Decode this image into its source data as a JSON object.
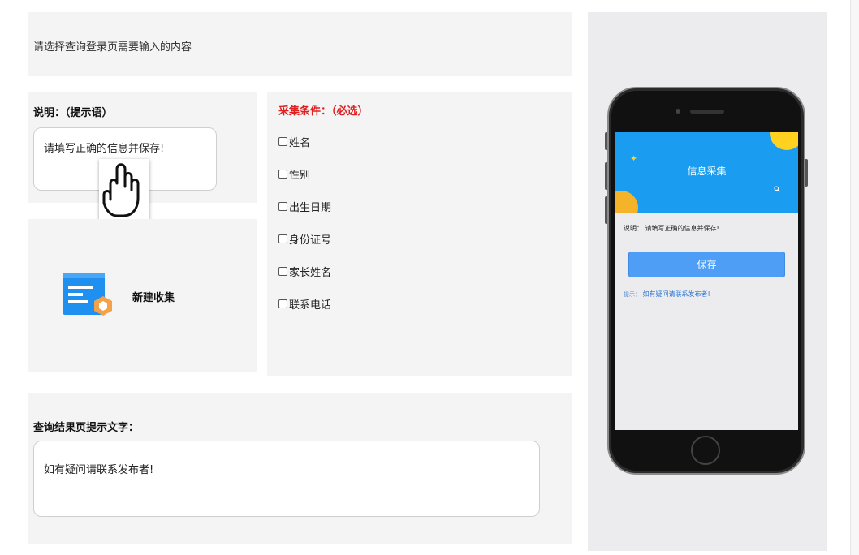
{
  "header": {
    "prompt": "请选择查询登录页需要输入的内容"
  },
  "description": {
    "label": "说明：（提示语）",
    "value": "请填写正确的信息并保存!"
  },
  "new_collection": {
    "label": "新建收集",
    "icon": "form-add-icon"
  },
  "collect_conditions": {
    "title": "采集条件：（必选）",
    "options": [
      {
        "label": "姓名",
        "checked": false
      },
      {
        "label": "性别",
        "checked": false
      },
      {
        "label": "出生日期",
        "checked": false
      },
      {
        "label": "身份证号",
        "checked": false
      },
      {
        "label": "家长姓名",
        "checked": false
      },
      {
        "label": "联系电话",
        "checked": false
      }
    ]
  },
  "result_page": {
    "label": "查询结果页提示文字：",
    "value": "如有疑问请联系发布者!"
  },
  "phone_preview": {
    "banner_title": "信息采集",
    "description": "说明：  请填写正确的信息并保存!",
    "save_button": "保存",
    "hint_label": "提示：",
    "hint_text": "如有疑问请联系发布者!",
    "colors": {
      "banner": "#1a9df0",
      "button": "#4e9ef5",
      "accent_yellow": "#ffd21f"
    }
  },
  "colors": {
    "required_title": "#e02020",
    "panel_bg": "#f4f4f4"
  }
}
